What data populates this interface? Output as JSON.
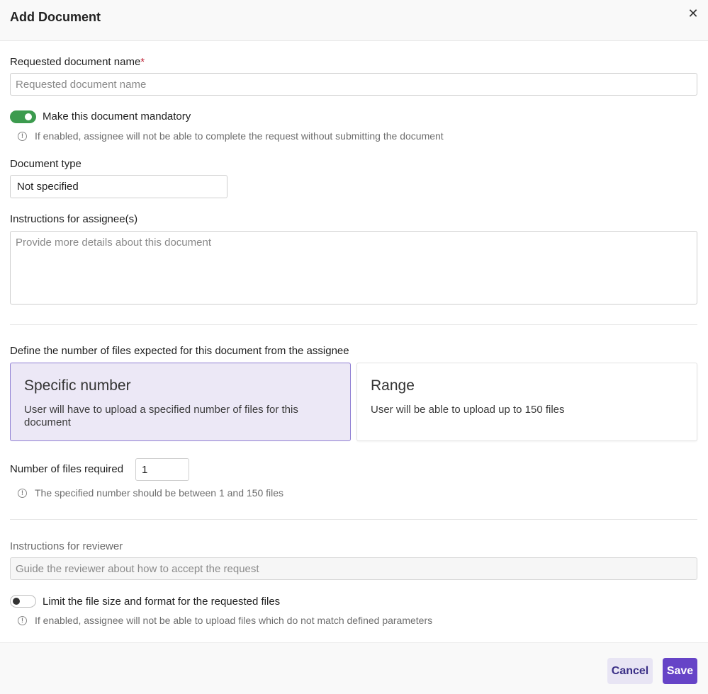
{
  "header": {
    "title": "Add Document",
    "close_icon": "close-icon",
    "close_glyph": "✕"
  },
  "doc_name": {
    "label": "Requested document name",
    "required_mark": "*",
    "placeholder": "Requested document name",
    "value": ""
  },
  "mandatory": {
    "toggle_on": true,
    "label": "Make this document mandatory",
    "hint": "If enabled, assignee will not be able to complete the request without submitting the document"
  },
  "doc_type": {
    "label": "Document type",
    "value": "Not specified"
  },
  "instructions": {
    "label": "Instructions for assignee(s)",
    "placeholder": "Provide more details about this document"
  },
  "files": {
    "label": "Define the number of files expected for this document from the assignee",
    "options": [
      {
        "title": "Specific number",
        "desc": "User will have to upload a specified number of files for this document",
        "selected": true
      },
      {
        "title": "Range",
        "desc": "User will be able to upload up to 150 files",
        "selected": false
      }
    ],
    "count_label": "Number of files required",
    "count_value": "1",
    "count_hint": "The specified number should be between 1 and 150 files"
  },
  "reviewer": {
    "label": "Instructions for reviewer",
    "placeholder": "Guide the reviewer about how to accept the request"
  },
  "limit": {
    "toggle_on": false,
    "label": "Limit the file size and format for the requested files",
    "hint": "If enabled, assignee will not be able to upload files which do not match defined parameters"
  },
  "footer": {
    "cancel_label": "Cancel",
    "save_label": "Save"
  },
  "colors": {
    "accent": "#6644c7",
    "toggle_on": "#3c9b4e",
    "selected_card": "#ece8f6"
  }
}
